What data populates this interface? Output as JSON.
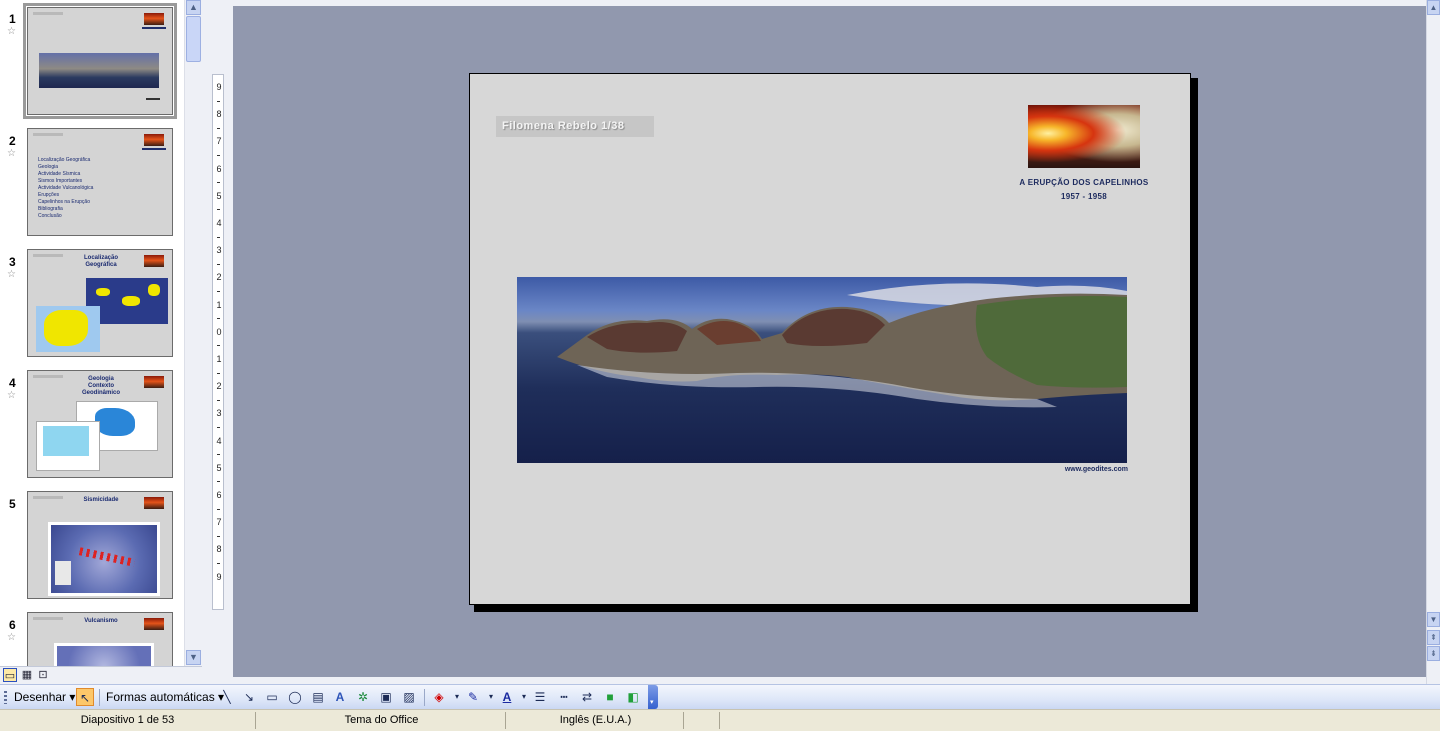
{
  "thumbnails": [
    {
      "number": "1",
      "star": "☆",
      "selected": true
    },
    {
      "number": "2",
      "star": "☆",
      "bullets": [
        "Localização Geográfica",
        "Geologia",
        "Actividade Sísmica",
        "Sismos Importantes",
        "Actividade Vulcanológica",
        "Erupções",
        "Capelinhos na Erupção",
        "Bibliografia",
        "Conclusão"
      ]
    },
    {
      "number": "3",
      "star": "☆",
      "title": "Localização Geográfica"
    },
    {
      "number": "4",
      "star": "☆",
      "title": "Geologia Contexto Geodinâmico"
    },
    {
      "number": "5",
      "star": "",
      "title": "Sismicidade"
    },
    {
      "number": "6",
      "star": "☆",
      "title": "Vulcanismo"
    }
  ],
  "ruler": {
    "labels": [
      "9",
      "8",
      "7",
      "6",
      "5",
      "4",
      "3",
      "2",
      "1",
      "0",
      "1",
      "2",
      "3",
      "4",
      "5",
      "6",
      "7",
      "8",
      "9"
    ]
  },
  "slide": {
    "author": "Filomena Rebelo 1/38",
    "caption_line1": "A ERUPÇÃO DOS CAPELINHOS",
    "caption_line2": "1957 - 1958",
    "credit": "www.geodites.com"
  },
  "view_buttons": {
    "normal": "▭",
    "sorter": "▦",
    "show": "⊡"
  },
  "draw_toolbar": {
    "draw_menu": "Desenhar",
    "autoshapes_menu": "Formas automáticas",
    "dropdown_arrow": "▾",
    "icons": [
      "select-pointer-icon",
      "line-icon",
      "arrow-icon",
      "rectangle-icon",
      "oval-icon",
      "textbox-icon",
      "wordart-icon",
      "diagram-icon",
      "clipart-icon",
      "picture-icon",
      "fill-color-icon",
      "line-color-icon",
      "font-color-icon",
      "line-style-icon",
      "dash-style-icon",
      "arrow-style-icon",
      "shadow-icon",
      "3d-icon"
    ]
  },
  "status_bar": {
    "slide_info": "Diapositivo 1 de 53",
    "theme": "Tema do Office",
    "language": "Inglês (E.U.A.)"
  },
  "colors": {
    "workspace": "#9198ae",
    "slide_bg": "#d7d7d7",
    "caption": "#1c2a5e"
  }
}
